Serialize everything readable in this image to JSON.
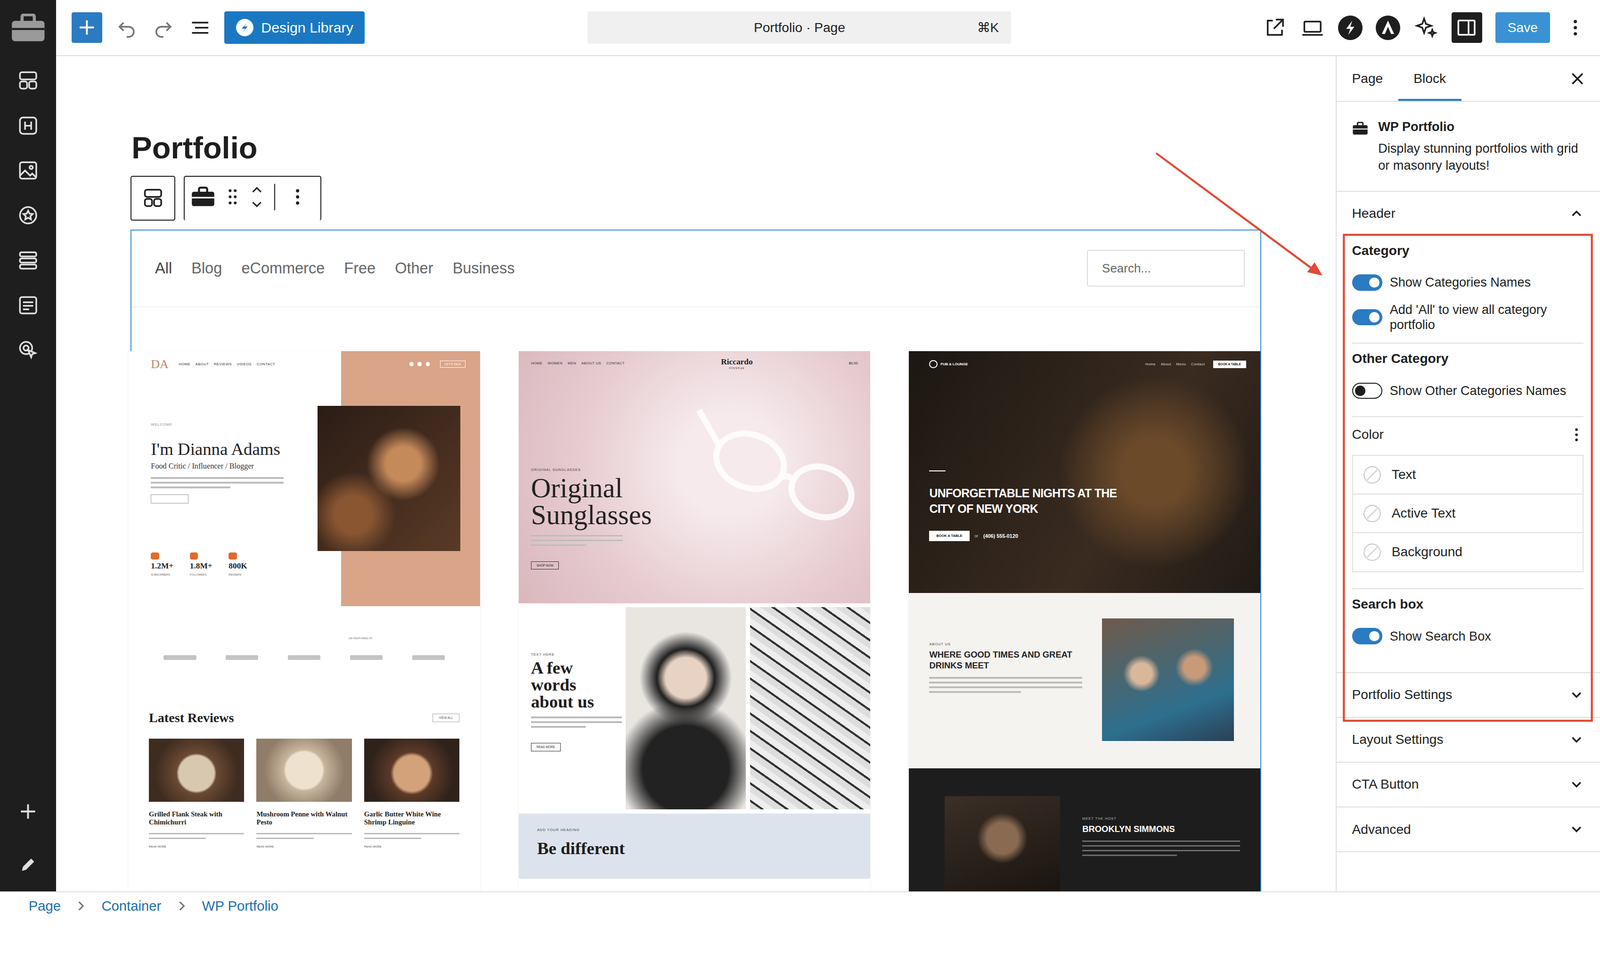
{
  "topbar": {
    "design_library": "Design Library",
    "document_title": "Portfolio · Page",
    "shortcut": "⌘K",
    "save": "Save"
  },
  "page_title": "Portfolio",
  "portfolio": {
    "filters": [
      {
        "label": "All",
        "selected": true
      },
      {
        "label": "Blog",
        "selected": false
      },
      {
        "label": "eCommerce",
        "selected": false
      },
      {
        "label": "Free",
        "selected": false
      },
      {
        "label": "Other",
        "selected": false
      },
      {
        "label": "Business",
        "selected": false
      }
    ],
    "search_placeholder": "Search...",
    "items": [
      {
        "kind": "blogger",
        "logo": "DA",
        "nav": [
          "HOME",
          "ABOUT",
          "REVIEWS",
          "VIDEOS",
          "CONTACT"
        ],
        "nav_button": "LET'S TALK",
        "kicker": "WELCOME",
        "heading": "I'm Dianna Adams",
        "subheading": "Food Critic / Influencer / Blogger",
        "stats": [
          {
            "value": "1.2M+",
            "label": "SUBSCRIBERS"
          },
          {
            "value": "1.8M+",
            "label": "FOLLOWERS"
          },
          {
            "value": "800K",
            "label": "READERS"
          }
        ],
        "featured": "AS FEATURED IN",
        "section": "Latest Reviews",
        "section_button": "VIEW ALL",
        "reviews": [
          {
            "title": "Grilled Flank Steak with Chimichurri",
            "link": "READ MORE"
          },
          {
            "title": "Mushroom Penne with Walnut Pesto",
            "link": "READ MORE"
          },
          {
            "title": "Garlic Butter White Wine Shrimp Linguine",
            "link": "READ MORE"
          }
        ]
      },
      {
        "kind": "shop",
        "logo": "Riccardo",
        "logo_sub": "EYEWEAR",
        "nav": [
          "HOME",
          "WOMEN",
          "MEN",
          "ABOUT US",
          "CONTACT"
        ],
        "cart": "$0.00",
        "kicker": "ORIGINAL SUNGLASSES",
        "heading": "Original Sunglasses",
        "button": "SHOP NOW",
        "about_kicker": "TEXT HERE",
        "about_heading": "A few words about us",
        "about_button": "READ MORE",
        "footer_kicker": "ADD YOUR HEADING",
        "footer_heading": "Be different"
      },
      {
        "kind": "bar",
        "logo": "PUB & LOUNGE",
        "nav": [
          "Home",
          "About",
          "Menu",
          "Contact"
        ],
        "nav_button": "BOOK A TABLE",
        "heading": "UNFORGETTABLE NIGHTS AT THE CITY OF NEW YORK",
        "button": "BOOK A TABLE",
        "or": "or",
        "phone": "(406) 555-0120",
        "about_kicker": "ABOUT US",
        "about_heading": "WHERE GOOD TIMES AND GREAT DRINKS MEET",
        "host_kicker": "MEET THE HOST",
        "host_name": "BROOKLYN SIMMONS"
      }
    ]
  },
  "inspector": {
    "tabs": [
      {
        "label": "Page",
        "selected": false
      },
      {
        "label": "Block",
        "selected": true
      }
    ],
    "block": {
      "name": "WP Portfolio",
      "description": "Display stunning portfolios with grid or masonry layouts!"
    },
    "header": {
      "title": "Header",
      "expanded": true,
      "groups": [
        {
          "kind": "toggles",
          "title": "Category",
          "toggles": [
            {
              "label": "Show Categories Names",
              "on": true
            },
            {
              "label": "Add 'All' to view all category portfolio",
              "on": true
            }
          ]
        },
        {
          "kind": "toggles",
          "title": "Other Category",
          "toggles": [
            {
              "label": "Show Other Categories Names",
              "on": false
            }
          ]
        },
        {
          "kind": "colors",
          "title": "Color",
          "colors": [
            {
              "label": "Text"
            },
            {
              "label": "Active Text"
            },
            {
              "label": "Background"
            }
          ]
        },
        {
          "kind": "toggles",
          "title": "Search box",
          "toggles": [
            {
              "label": "Show Search Box",
              "on": true
            }
          ]
        }
      ]
    },
    "panels": [
      {
        "title": "Portfolio Settings",
        "expanded": false
      },
      {
        "title": "Layout Settings",
        "expanded": false
      },
      {
        "title": "CTA Button",
        "expanded": false
      },
      {
        "title": "Advanced",
        "expanded": false
      }
    ]
  },
  "breadcrumb": [
    "Page",
    "Container",
    "WP Portfolio"
  ]
}
